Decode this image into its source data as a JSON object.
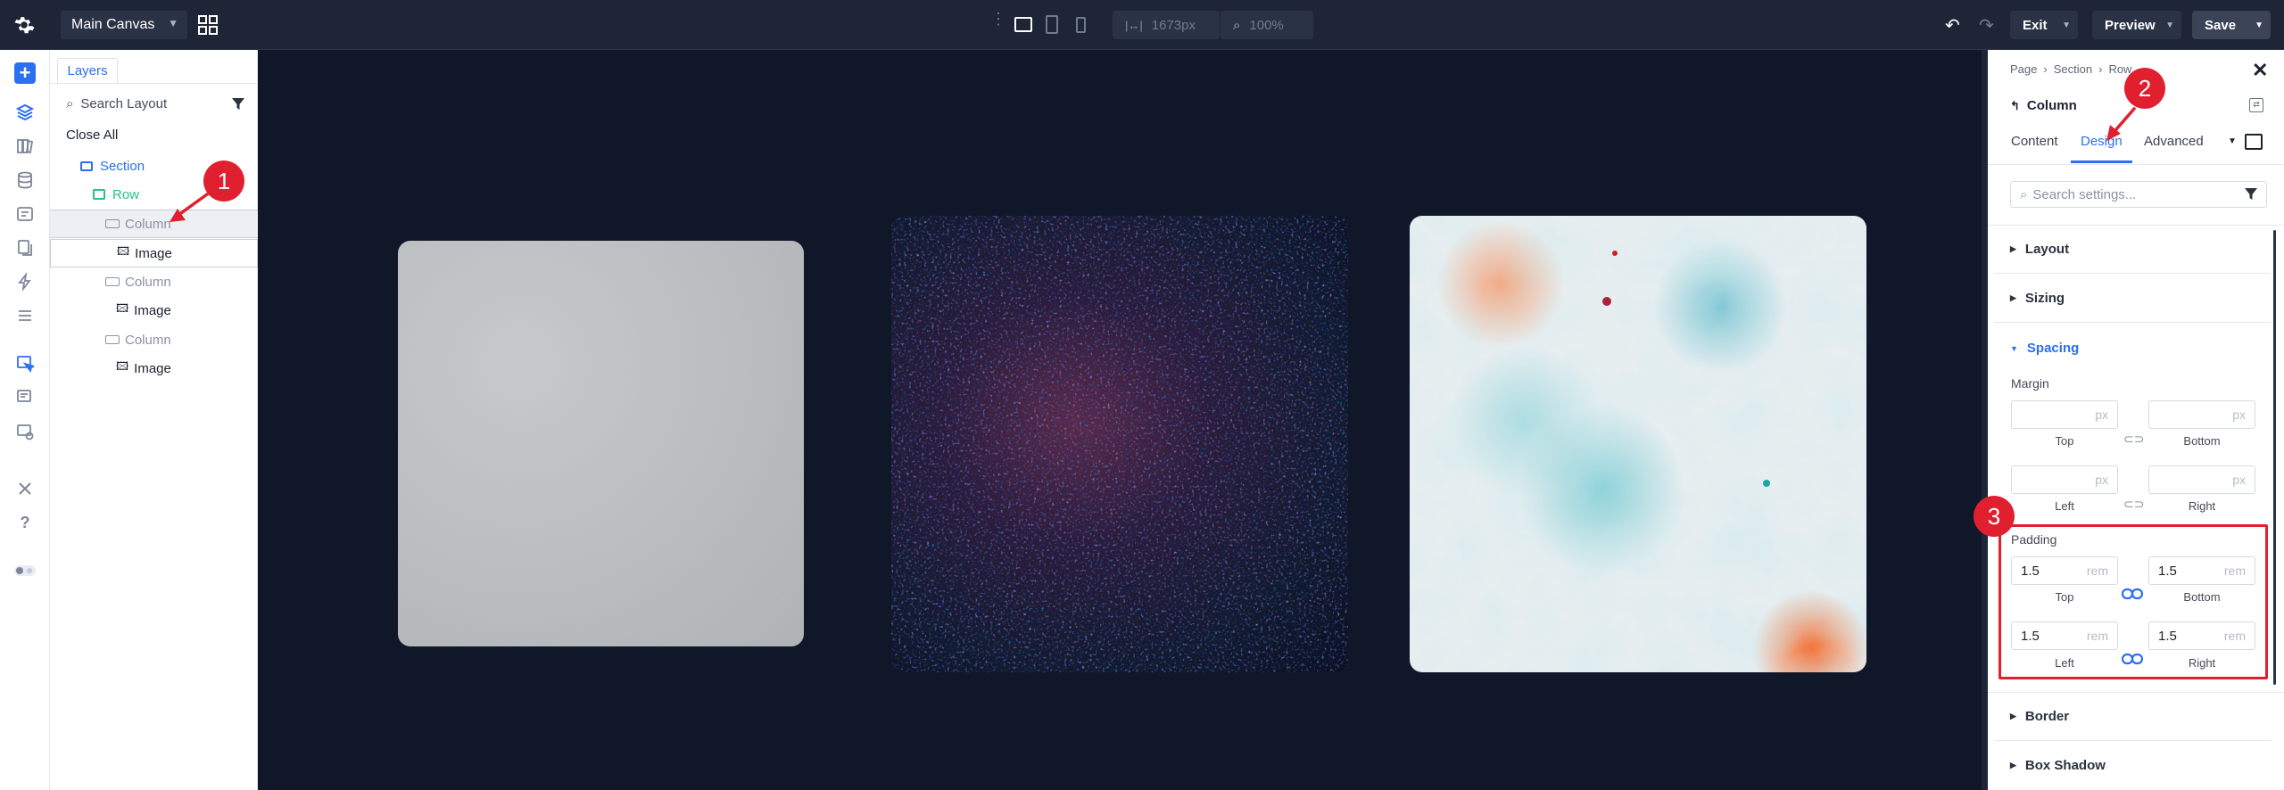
{
  "topbar": {
    "canvas_select": "Main Canvas",
    "width_value": "1673px",
    "zoom_value": "100%",
    "exit_label": "Exit",
    "preview_label": "Preview",
    "save_label": "Save"
  },
  "layers": {
    "tab_label": "Layers",
    "search_placeholder": "Search Layout",
    "close_all": "Close All",
    "items": [
      {
        "label": "Section"
      },
      {
        "label": "Row"
      },
      {
        "label": "Column"
      },
      {
        "label": "Image"
      },
      {
        "label": "Column"
      },
      {
        "label": "Image"
      },
      {
        "label": "Column"
      },
      {
        "label": "Image"
      }
    ]
  },
  "settings": {
    "breadcrumb": [
      "Page",
      "Section",
      "Row"
    ],
    "module_title": "Column",
    "tabs": [
      "Content",
      "Design",
      "Advanced"
    ],
    "active_tab": "Design",
    "search_placeholder": "Search settings...",
    "groups": [
      "Layout",
      "Sizing",
      "Spacing",
      "Border",
      "Box Shadow"
    ],
    "margin": {
      "label": "Margin",
      "unit": "px",
      "top_label": "Top",
      "bottom_label": "Bottom",
      "left_label": "Left",
      "right_label": "Right"
    },
    "padding": {
      "label": "Padding",
      "unit": "rem",
      "top": "1.5",
      "bottom": "1.5",
      "left": "1.5",
      "right": "1.5",
      "top_label": "Top",
      "bottom_label": "Bottom",
      "left_label": "Left",
      "right_label": "Right"
    }
  },
  "markers": [
    "1",
    "2",
    "3"
  ],
  "colors": {
    "accent": "#2b6ff2",
    "row_green": "#27c08a",
    "marker_red": "#e0202e",
    "canvas_bg": "#0f1729"
  }
}
